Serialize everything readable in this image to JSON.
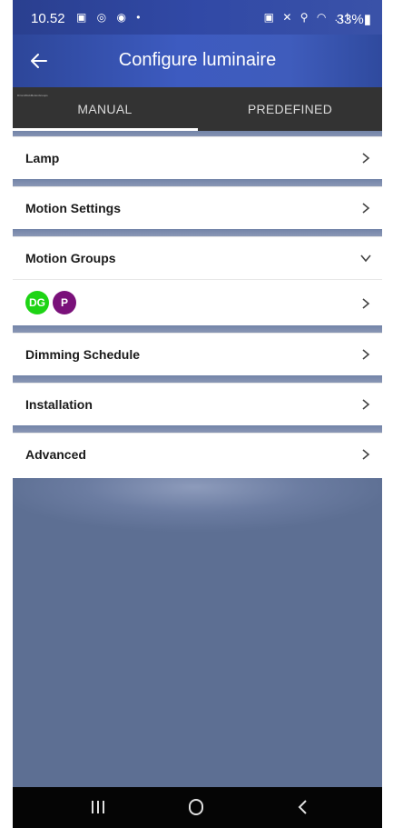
{
  "status_bar": {
    "time": "10.52",
    "left_icons": "▣ ◎ ◉ •",
    "right_icons": "▣ ✕ ⚲ ◠ .ıl",
    "battery": "33%▮"
  },
  "app_bar": {
    "title": "Configure luminaire",
    "back_icon": "arrow-left-icon"
  },
  "tabs": [
    {
      "label": "MANUAL",
      "active": true
    },
    {
      "label": "PREDEFINED",
      "active": false
    }
  ],
  "tiny_label": "DimmWorkMotionGroups",
  "rows": [
    {
      "label": "Lamp"
    },
    {
      "label": "Motion Settings"
    },
    {
      "label": "Motion Groups",
      "expanded": true
    },
    {
      "label": "Dimming Schedule"
    },
    {
      "label": "Installation"
    },
    {
      "label": "Advanced"
    }
  ],
  "motion_groups": {
    "badges": [
      {
        "text": "DG",
        "color": "#1ed415"
      },
      {
        "text": "P",
        "color": "#7a117a"
      }
    ]
  },
  "nav_bar": {
    "recents_icon": "recents-icon",
    "home_icon": "home-icon",
    "back_icon": "back-icon"
  }
}
